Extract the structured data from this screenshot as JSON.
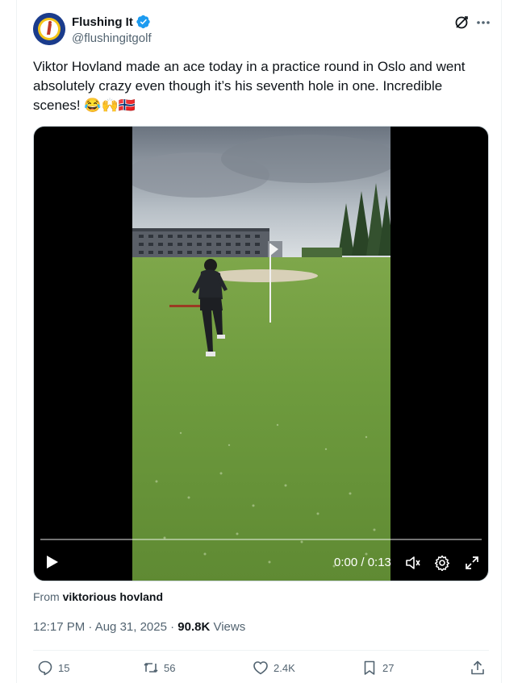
{
  "author": {
    "name": "Flushing It",
    "handle": "@flushingitgolf"
  },
  "tweet": {
    "text": "Viktor Hovland made an ace today in a practice round in Oslo and went absolutely crazy even though it’s his seventh hole in one. Incredible scenes! 😂🙌🇳🇴"
  },
  "video": {
    "time_label": "0:00 / 0:13",
    "progress": 0.0
  },
  "source": {
    "prefix": "From",
    "name": "viktorious hovland"
  },
  "meta": {
    "time_date": "12:17 PM · Aug 31, 2025 · ",
    "views_count": "90.8K",
    "views_label": " Views"
  },
  "actions": {
    "replies": "15",
    "reposts": "56",
    "likes": "2.4K",
    "bookmarks": "27"
  },
  "colors": {
    "verified": "#1d9bf0",
    "muted": "#536471",
    "text": "#0f1419"
  }
}
